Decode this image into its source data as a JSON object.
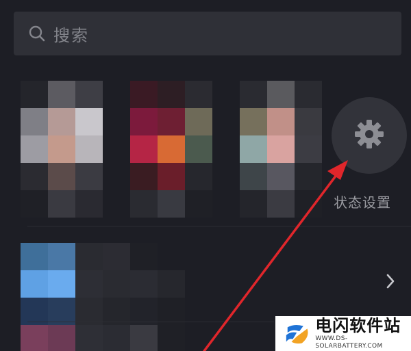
{
  "search": {
    "placeholder_text": "搜索",
    "icon": "search-icon"
  },
  "status_settings": {
    "label": "状态设置",
    "icon": "gear-icon"
  },
  "list_row": {
    "icon": "chevron-right-icon"
  },
  "watermark": {
    "title": "电闪软件站",
    "url": "WWW.DS-SOLARBATTERY.COM"
  },
  "colors": {
    "background": "#1d1e25",
    "search_bar": "#2f3037",
    "settings_circle": "#32333a",
    "arrow": "#e0262b"
  }
}
